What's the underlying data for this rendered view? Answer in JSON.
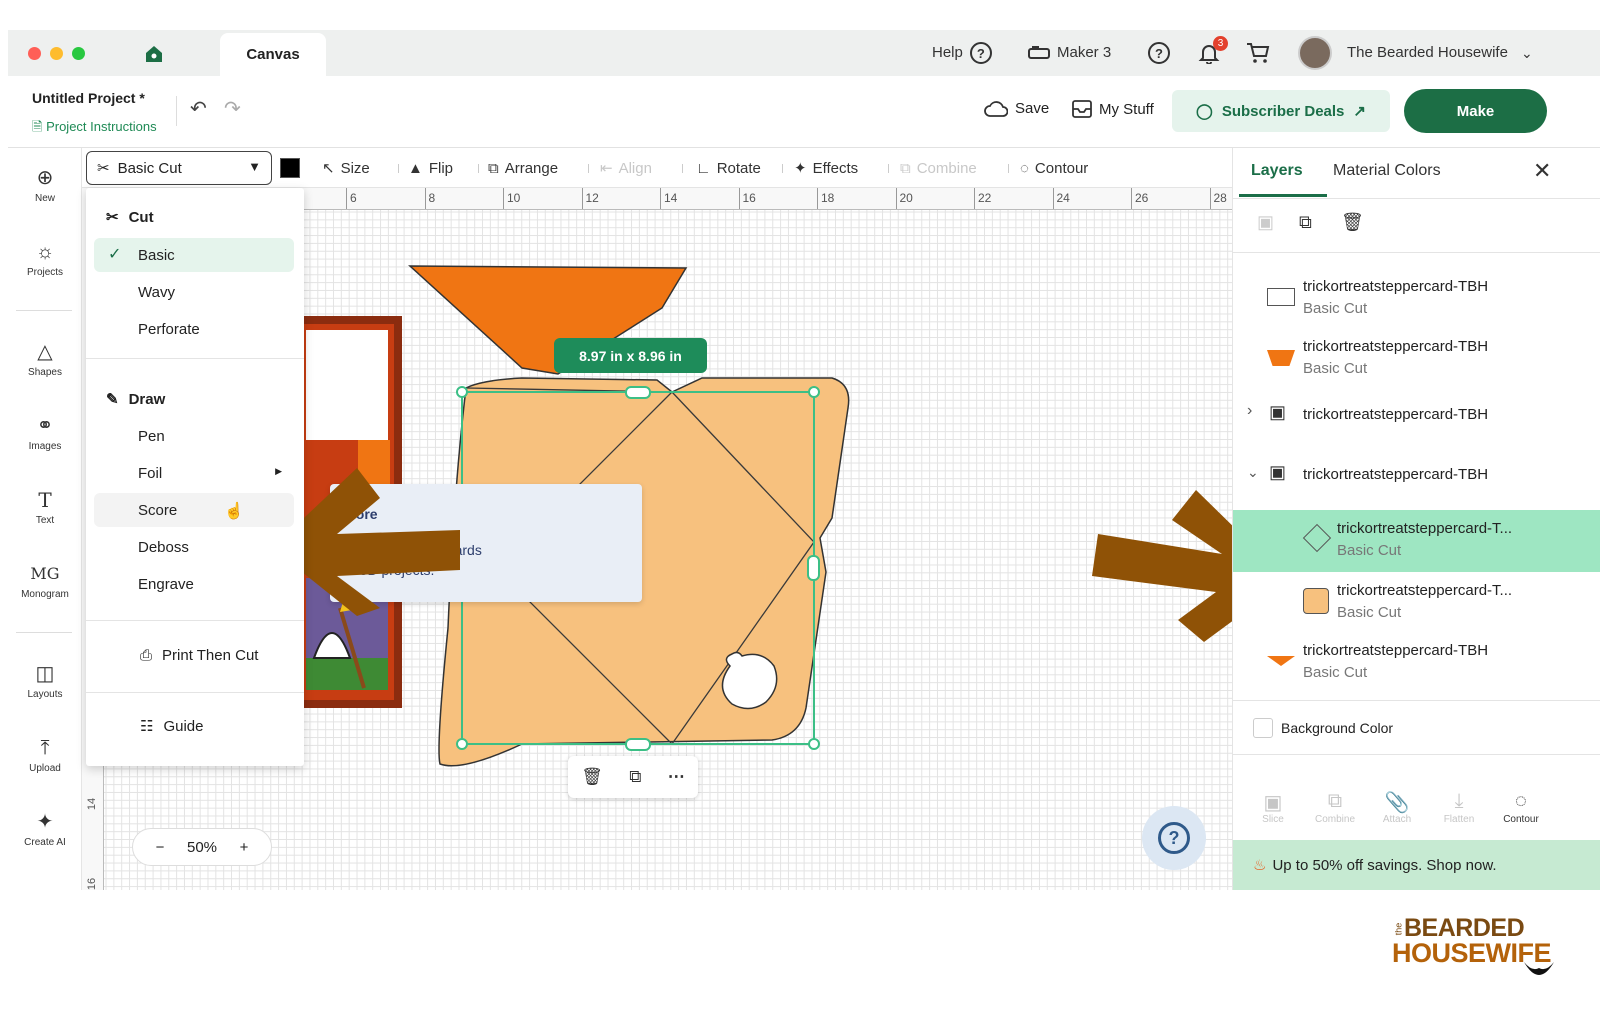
{
  "titlebar": {
    "tab_label": "Canvas",
    "help_label": "Help",
    "machine_label": "Maker 3",
    "notification_count": "3",
    "user_name": "The Bearded Housewife"
  },
  "project": {
    "name": "Untitled Project *",
    "instructions_label": "Project Instructions",
    "save_label": "Save",
    "mystuff_label": "My Stuff",
    "subscriber_label": "Subscriber Deals",
    "make_label": "Make"
  },
  "leftrail": {
    "items": [
      {
        "label": "New",
        "icon": "plus-circle-icon"
      },
      {
        "label": "Projects",
        "icon": "projects-icon"
      },
      {
        "label": "Shapes",
        "icon": "shapes-icon"
      },
      {
        "label": "Images",
        "icon": "lightbulb-icon"
      },
      {
        "label": "Text",
        "icon": "text-icon"
      },
      {
        "label": "Monogram",
        "icon": "monogram-icon"
      },
      {
        "label": "Layouts",
        "icon": "shirt-icon"
      },
      {
        "label": "Upload",
        "icon": "upload-icon"
      },
      {
        "label": "Create AI",
        "icon": "sparkle-icon"
      }
    ]
  },
  "toolbar": {
    "operation_label": "Basic Cut",
    "swatch_color": "#000000",
    "size_label": "Size",
    "flip_label": "Flip",
    "arrange_label": "Arrange",
    "align_label": "Align",
    "rotate_label": "Rotate",
    "effects_label": "Effects",
    "combine_label": "Combine",
    "contour_label": "Contour"
  },
  "op_menu": {
    "cut_header": "Cut",
    "basic": "Basic",
    "wavy": "Wavy",
    "perforate": "Perforate",
    "draw_header": "Draw",
    "pen": "Pen",
    "foil": "Foil",
    "score": "Score",
    "deboss": "Deboss",
    "engrave": "Engrave",
    "print_then_cut": "Print Then Cut",
    "guide": "Guide"
  },
  "canvas": {
    "ruler_ticks": [
      "6",
      "8",
      "10",
      "12",
      "14",
      "16",
      "18",
      "20",
      "22",
      "24",
      "26",
      "28"
    ],
    "ruler_v_ticks": [
      "14",
      "16"
    ],
    "dimension_badge": "8.97 in x 8.96 in",
    "tooltip_title": "core",
    "tooltip_line1": "...ses for folded cards",
    "tooltip_line2": "d 3D projects.",
    "zoom_label": "50%",
    "colors": {
      "orange": "#f07513",
      "peach": "#f7c17e",
      "selection": "#3cbf86",
      "arrow": "#8f5206"
    }
  },
  "panel": {
    "tab_layers": "Layers",
    "tab_material": "Material Colors",
    "layers": [
      {
        "name": "trickortreatsteppercard-TBH",
        "op": "Basic Cut",
        "swatch": "outline-white"
      },
      {
        "name": "trickortreatsteppercard-TBH",
        "op": "Basic Cut",
        "swatch": "orange"
      },
      {
        "name": "trickortreatsteppercard-TBH",
        "op": "",
        "swatch": "group"
      },
      {
        "name": "trickortreatsteppercard-TBH",
        "op": "",
        "swatch": "group"
      },
      {
        "name": "trickortreatsteppercard-T...",
        "op": "Basic Cut",
        "swatch": "diamond"
      },
      {
        "name": "trickortreatsteppercard-T...",
        "op": "Basic Cut",
        "swatch": "peach"
      },
      {
        "name": "trickortreatsteppercard-TBH",
        "op": "Basic Cut",
        "swatch": "orange-sliver"
      }
    ],
    "background_label": "Background Color",
    "bottom_tools": [
      "Slice",
      "Combine",
      "Attach",
      "Flatten",
      "Contour"
    ],
    "promo_text": "Up to 50% off savings. Shop now."
  },
  "watermark": {
    "line1": "BEARDED",
    "line2": "HOUSEWIFE",
    "prefix": "the"
  }
}
